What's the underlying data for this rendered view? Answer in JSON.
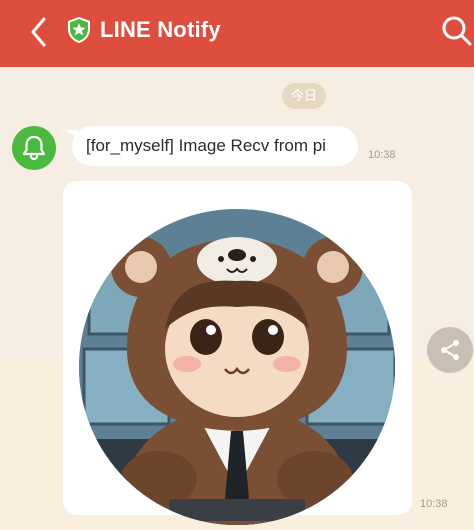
{
  "header": {
    "title": "LINE Notify",
    "back_icon": "chevron-left-icon",
    "brand_icon": "shield-star-icon",
    "search_icon": "search-icon",
    "color": "#de4e3f"
  },
  "chat": {
    "date_label": "今日",
    "messages": [
      {
        "type": "text",
        "text": "[for_myself] Image Recv from pi",
        "time": "10:38",
        "sender_icon": "bell-icon"
      },
      {
        "type": "image",
        "image_icon": "bear-hoodie-avatar-illustration",
        "time": "10:38"
      }
    ],
    "share_icon": "share-icon",
    "avatar_color": "#4aba3f"
  }
}
